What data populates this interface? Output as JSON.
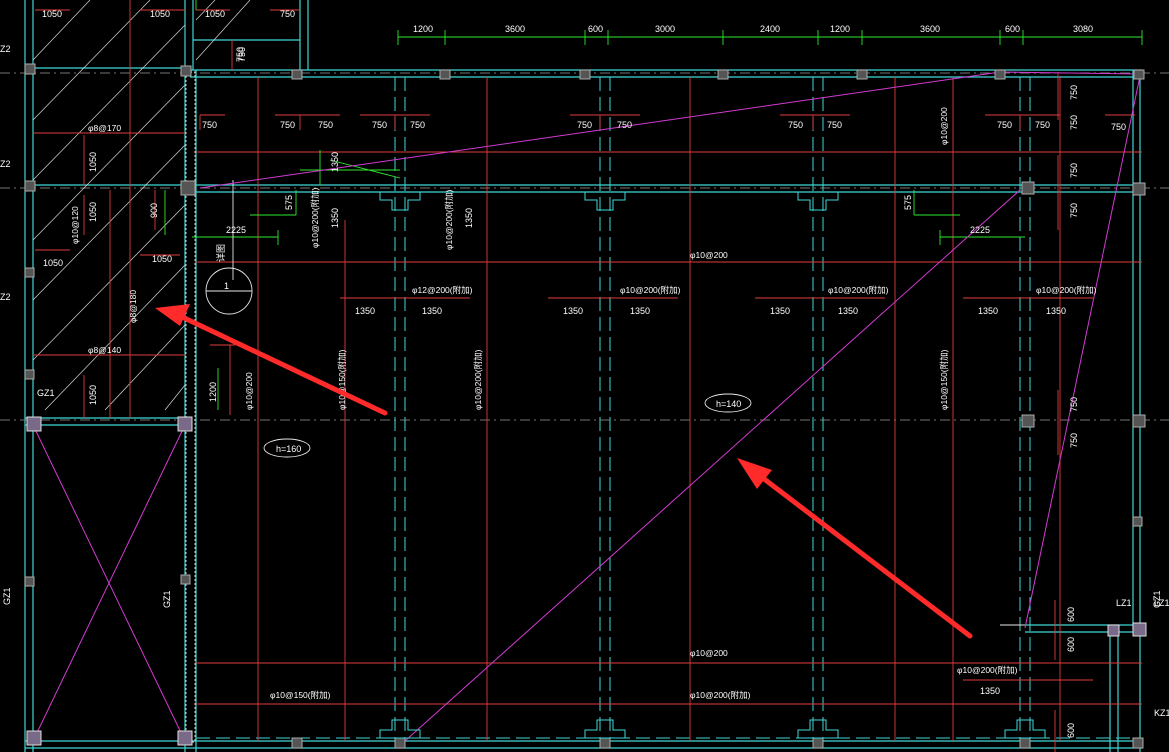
{
  "drawing": {
    "top_dims": [
      "1200",
      "3600",
      "600",
      "3000",
      "2400",
      "1200",
      "3600",
      "600",
      "3080"
    ],
    "top_left_dims": [
      "1050",
      "1050",
      "1050",
      "750",
      "750"
    ],
    "dims_750": [
      "750",
      "750",
      "750",
      "750",
      "750",
      "750",
      "750",
      "750",
      "750",
      "750",
      "750",
      "750",
      "750",
      "750"
    ],
    "dims_1350": [
      "1350",
      "1350",
      "1350",
      "1350",
      "1350",
      "1350",
      "1350",
      "1350",
      "1350"
    ],
    "dims_misc": {
      "d1050_a": "1050",
      "d1050_b": "1050",
      "d1050_c": "1050",
      "d1050_d": "1050",
      "d1050_e": "1050",
      "d900": "900",
      "d575_a": "575",
      "d575_b": "575",
      "d2225_a": "2225",
      "d2225_b": "2225",
      "d1350_v1": "1350",
      "d1350_v2": "1350",
      "d1350_v3": "1350",
      "d1200": "1200",
      "d600_a": "600",
      "d600_b": "600",
      "d600_c": "600",
      "d750_r1": "750",
      "d750_r2": "750",
      "d750_r3": "750",
      "d750_r4": "750",
      "d750_r5": "750"
    },
    "rebar": {
      "r1": "φ8@170",
      "r2": "φ10@120",
      "r3": "φ8@180",
      "r4": "φ8@140",
      "r5": "φ10@200(附加)",
      "r6": "φ10@200(附加)",
      "r7": "φ12@200(附加)",
      "r8": "φ10@200(附加)",
      "r9": "φ10@200(附加)",
      "r10": "φ10@200(附加)",
      "r11": "φ10@200",
      "r12": "φ10@150(附加)",
      "r13": "φ10@200(附加)",
      "r14": "φ10@150(附加)",
      "r15": "φ10@200",
      "r16": "φ10@200",
      "r17": "φ10@150(附加)",
      "r18": "φ10@200(附加)",
      "r19": "φ10@200(附加)",
      "r20": "φ10@200"
    },
    "labels": {
      "h160": "h=160",
      "h140": "h=140",
      "gz1_a": "GZ1",
      "gz1_b": "GZ1",
      "gz1_c": "GZ1",
      "gz1_d": "GZ1",
      "lz1_a": "LZ1",
      "lz1_b": "LZ1",
      "kz1": "KZ1",
      "z2_a": "Z2",
      "z2_b": "Z2",
      "z2_c": "Z2",
      "section_num": "1",
      "section_note": "详图"
    }
  },
  "colors": {
    "background": "#000000",
    "cyan": "#3fd6d6",
    "red": "#e03b3b",
    "white": "#e8e8e8",
    "green": "#2ee82e",
    "magenta": "#d23bd2",
    "arrow": "#ff2a2a"
  }
}
